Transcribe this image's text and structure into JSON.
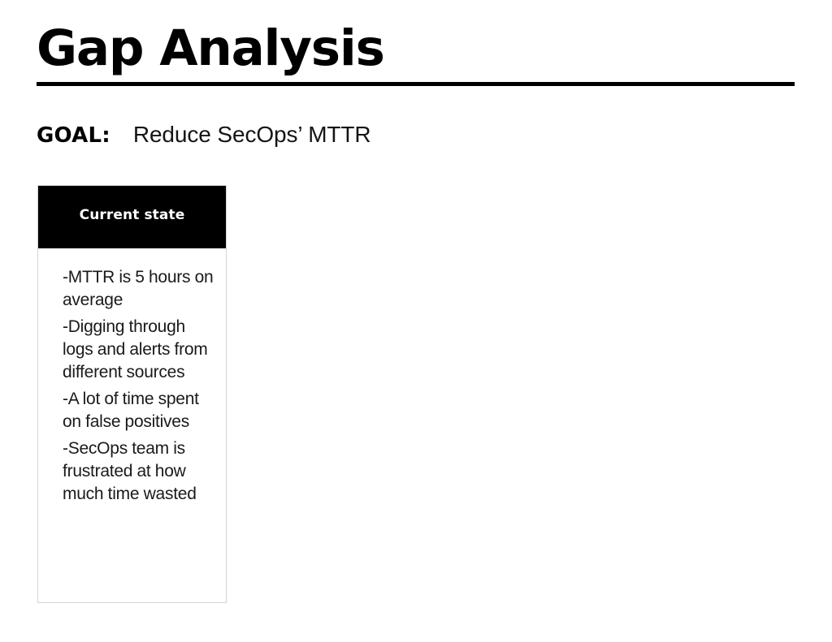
{
  "slide": {
    "title": "Gap Analysis",
    "background_color": "#ffffff",
    "rule_color": "#000000"
  },
  "goal": {
    "label": "GOAL:",
    "value": "Reduce SecOps’ MTTR"
  },
  "columns": [
    {
      "header": "Current state",
      "header_bg": "#000000",
      "header_text_color": "#ffffff",
      "border_color": "#d5d5d7",
      "bullets": [
        "-MTTR is 5 hours on average",
        "-Digging through logs and alerts from different sources",
        "-A lot of time spent on false positives",
        "-SecOps team is frustrated at how much time wasted"
      ]
    }
  ]
}
